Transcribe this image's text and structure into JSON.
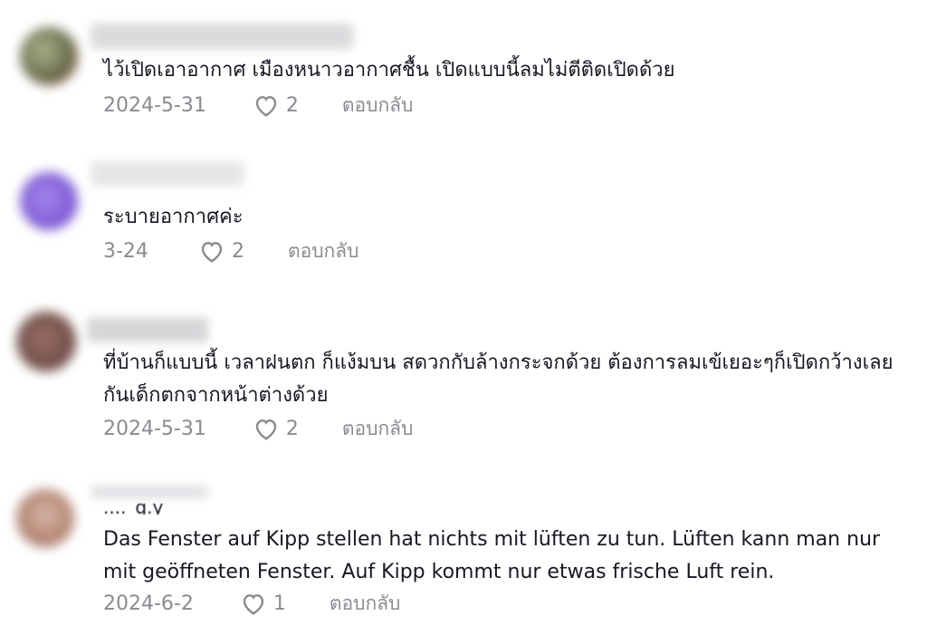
{
  "comments": [
    {
      "text": "ไว้เปิดเอาอากาศ เมืองหนาวอากาศชื้น เปิดแบบนี้ลมไม่ตีติดเปิดด้วย",
      "date": "2024-5-31",
      "likes": "2",
      "reply_label": "ตอบกลับ",
      "avatar_color": "#7b8a5c"
    },
    {
      "text": "ระบายอากาศค่ะ",
      "date": "3-24",
      "likes": "2",
      "reply_label": "ตอบกลับ",
      "avatar_color": "#8b6ad6"
    },
    {
      "text": "ที่บ้านก็แบบนี้ เวลาฝนตก ก็แง้มบน สดวกกับล้างกระจกด้วย ต้องการลมเข้เยอะๆก็เปิดกว้างเลย กันเด็กตกจากหน้าต่างด้วย",
      "date": "2024-5-31",
      "likes": "2",
      "reply_label": "ตอบกลับ",
      "avatar_color": "#7a5a52"
    },
    {
      "partial_name": "...._g.y",
      "text": "Das Fenster auf Kipp stellen hat nichts mit lüften zu tun. Lüften kann man nur mit geöffneten Fenster. Auf Kipp kommt nur etwas frische Luft rein.",
      "date": "2024-6-2",
      "likes": "1",
      "reply_label": "ตอบกลับ",
      "avatar_color": "#c9a79a"
    }
  ]
}
